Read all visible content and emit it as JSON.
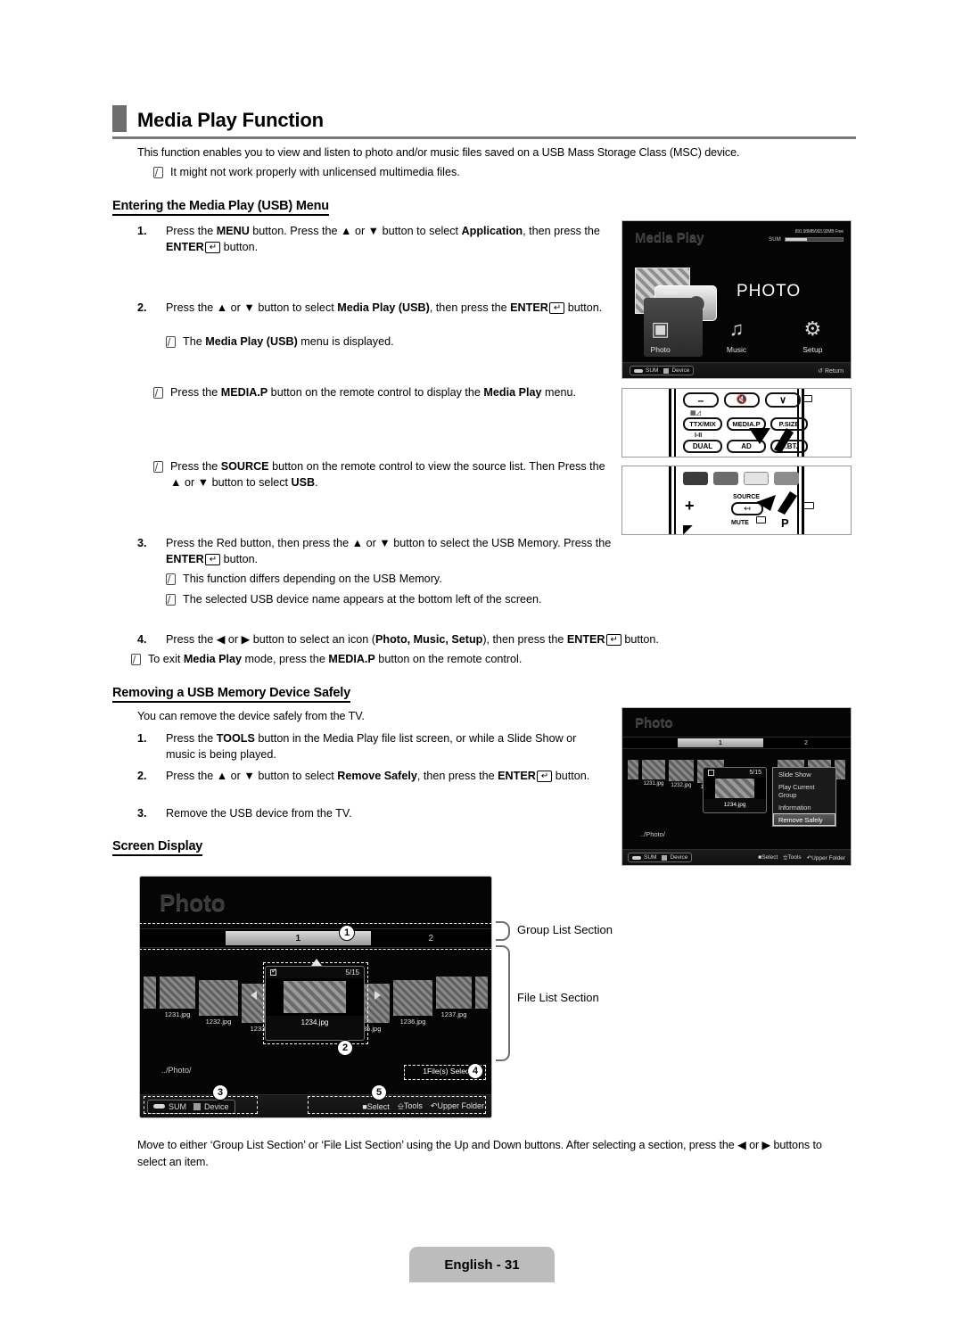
{
  "document": {
    "title": "Media Play Function",
    "footer_label": "English - 31"
  },
  "intro": {
    "paragraph": "This function enables you to view and listen to photo and/or music files saved on a USB Mass Storage Class (MSC) device.",
    "note": "It might not work properly with unlicensed multimedia files."
  },
  "section_entering": {
    "heading": "Entering the Media Play (USB) Menu",
    "steps": [
      {
        "num": "1.",
        "parts": [
          {
            "t": "Press the ",
            "b": false
          },
          {
            "t": "MENU",
            "b": true
          },
          {
            "t": " button. Press the ▲ or ▼ button to select ",
            "b": false
          },
          {
            "t": "Application",
            "b": true
          },
          {
            "t": ", then press the ",
            "b": false
          },
          {
            "t": "ENTER",
            "b": true
          },
          {
            "t": "KEY",
            "b": false
          },
          {
            "t": " button.",
            "b": false
          }
        ]
      },
      {
        "num": "2.",
        "parts": [
          {
            "t": "Press the ▲ or ▼ button to select ",
            "b": false
          },
          {
            "t": "Media Play (USB)",
            "b": true
          },
          {
            "t": ", then press the ",
            "b": false
          },
          {
            "t": "ENTER",
            "b": true
          },
          {
            "t": "KEY",
            "b": false
          },
          {
            "t": " button.",
            "b": false
          }
        ]
      },
      {
        "num": "3.",
        "parts": [
          {
            "t": "Press the Red button, then press the ▲ or ▼ button to select the USB Memory. Press the ",
            "b": false
          },
          {
            "t": "ENTER",
            "b": true
          },
          {
            "t": "KEY",
            "b": false
          },
          {
            "t": " button.",
            "b": false
          }
        ]
      },
      {
        "num": "4.",
        "parts": [
          {
            "t": "Press the ◀ or ▶ button to select an icon (",
            "b": false
          },
          {
            "t": "Photo, Music, Setup",
            "b": true
          },
          {
            "t": "), then press the ",
            "b": false
          },
          {
            "t": "ENTER",
            "b": true
          },
          {
            "t": "KEY",
            "b": false
          },
          {
            "t": " button.",
            "b": false
          }
        ]
      }
    ],
    "note_step2": [
      {
        "t": "The ",
        "b": false
      },
      {
        "t": "Media Play (USB)",
        "b": true
      },
      {
        "t": " menu is displayed.",
        "b": false
      }
    ],
    "note_mediap": [
      {
        "t": "Press the ",
        "b": false
      },
      {
        "t": "MEDIA.P",
        "b": true
      },
      {
        "t": " button on the remote control to display the ",
        "b": false
      },
      {
        "t": "Media Play",
        "b": true
      },
      {
        "t": " menu.",
        "b": false
      }
    ],
    "note_source": [
      {
        "t": "Press the ",
        "b": false
      },
      {
        "t": "SOURCE",
        "b": true
      },
      {
        "t": " button on the remote control to view the source list. Then Press the ▲ or ▼ button to select ",
        "b": false
      },
      {
        "t": "USB",
        "b": true
      },
      {
        "t": ".",
        "b": false
      }
    ],
    "note_differs": [
      {
        "t": "This function differs depending on the USB Memory.",
        "b": false
      }
    ],
    "note_devname": [
      {
        "t": "The selected USB device name appears at the bottom left of the screen.",
        "b": false
      }
    ],
    "note_exit": [
      {
        "t": "To exit ",
        "b": false
      },
      {
        "t": "Media Play",
        "b": true
      },
      {
        "t": " mode, press the ",
        "b": false
      },
      {
        "t": "MEDIA.P",
        "b": true
      },
      {
        "t": " button on the remote control.",
        "b": false
      }
    ]
  },
  "section_removing": {
    "heading": "Removing a USB Memory Device Safely",
    "lead": "You can remove the device safely from the TV.",
    "steps": [
      {
        "num": "1.",
        "parts": [
          {
            "t": "Press the ",
            "b": false
          },
          {
            "t": "TOOLS",
            "b": true
          },
          {
            "t": " button in the Media Play file list screen, or while a Slide Show or music is being played.",
            "b": false
          }
        ]
      },
      {
        "num": "2.",
        "parts": [
          {
            "t": "Press the ▲ or ▼ button to select ",
            "b": false
          },
          {
            "t": "Remove Safely",
            "b": true
          },
          {
            "t": ", then press the ",
            "b": false
          },
          {
            "t": "ENTER",
            "b": true
          },
          {
            "t": "KEY",
            "b": false
          },
          {
            "t": " button.",
            "b": false
          }
        ]
      },
      {
        "num": "3.",
        "parts": [
          {
            "t": "Remove the USB device from the TV.",
            "b": false
          }
        ]
      }
    ]
  },
  "section_screen_display": {
    "heading": "Screen Display",
    "callout_labels": {
      "group_list_section": "Group List Section",
      "file_list_section": "File List Section"
    },
    "badges": [
      "1",
      "2",
      "3",
      "4",
      "5"
    ],
    "closing_paragraph": "Move to either ‘Group List Section’ or ‘File List Section’ using the Up and Down buttons. After selecting a section, press the ◀ or ▶ buttons to select an item."
  },
  "tv_media_play": {
    "title": "Media Play",
    "device_label": "SUM",
    "storage_free": "891.98MB/993.92MB Free",
    "hero_label": "PHOTO",
    "icons": [
      {
        "label": "Photo",
        "glyph": "▣"
      },
      {
        "label": "Music",
        "glyph": "♫"
      },
      {
        "label": "Setup",
        "glyph": "⚙"
      }
    ],
    "bottom_left_device": "SUM",
    "bottom_device_key": "Device",
    "bottom_return": "Return",
    "return_glyph": "↺"
  },
  "tv_photo_tools": {
    "title": "Photo",
    "groups": [
      {
        "label": "1",
        "selected": true
      },
      {
        "label": "2",
        "selected": false
      }
    ],
    "files": [
      "1231.jpg",
      "1232.jpg",
      "1233.jpg",
      "1234.jpg",
      "1235.jpg",
      "1236.jpg",
      "1237.jpg"
    ],
    "selected_file": "1234.jpg",
    "counter": "5/15",
    "tools_menu": [
      "Slide Show",
      "Play Current Group",
      "Information",
      "Remove Safely"
    ],
    "tools_menu_selected": "Remove Safely",
    "path": "../Photo/",
    "bottom_left_device": "SUM",
    "bottom_device_key": "Device",
    "bottom_actions": [
      "Select",
      "Tools",
      "Upper Folder"
    ]
  },
  "tv_screen_display": {
    "title": "Photo",
    "groups": [
      {
        "label": "1",
        "selected": true
      },
      {
        "label": "2",
        "selected": false
      }
    ],
    "files": [
      "1231.jpg",
      "1232.jpg",
      "1233.jpg",
      "1234.jpg",
      "1235.jpg",
      "1236.jpg",
      "1237.jpg"
    ],
    "selected_file": "1234.jpg",
    "counter": "5/15",
    "path": "../Photo/",
    "files_selected": "1File(s) Selected",
    "bottom_left_device": "SUM",
    "bottom_device_key": "Device",
    "bottom_actions": [
      "Select",
      "Tools",
      "Upper Folder"
    ]
  },
  "remote": {
    "panel_top": {
      "row0": [
        "–",
        "MUTE",
        "∨"
      ],
      "row1": [
        "TTX/MIX",
        "MEDIA.P",
        "P.SIZE"
      ],
      "row2": [
        "DUAL",
        "AD",
        "S.BT."
      ],
      "sub_label_left": "I-II",
      "highlight": "MEDIA.P"
    },
    "panel_bottom": {
      "color_buttons": 4,
      "source_label": "SOURCE",
      "mute_label": "MUTE",
      "p_label": "P",
      "plus_label": "+",
      "highlight": "SOURCE"
    }
  }
}
